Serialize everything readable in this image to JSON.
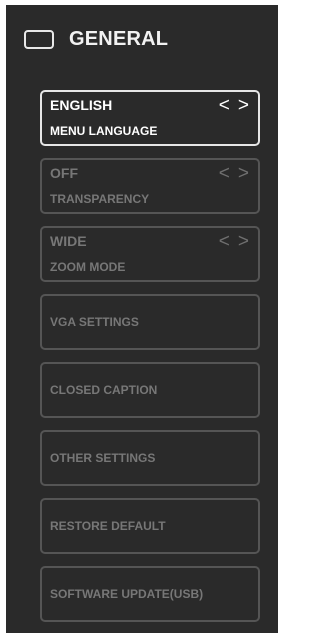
{
  "header": {
    "title": "GENERAL",
    "icon": "tv-screen-icon"
  },
  "items": [
    {
      "value": "ENGLISH",
      "label": "MENU LANGUAGE",
      "left_arrow": "<",
      "right_arrow": ">"
    },
    {
      "value": "OFF",
      "label": "TRANSPARENCY",
      "left_arrow": "<",
      "right_arrow": ">"
    },
    {
      "value": "WIDE",
      "label": "ZOOM MODE",
      "left_arrow": "<",
      "right_arrow": ">"
    },
    {
      "label": "VGA SETTINGS"
    },
    {
      "label": "CLOSED CAPTION"
    },
    {
      "label": "OTHER SETTINGS"
    },
    {
      "label": "RESTORE DEFAULT"
    },
    {
      "label": "SOFTWARE UPDATE(USB)"
    }
  ],
  "colors": {
    "panel_bg": "#2a2a2a",
    "active": "#ffffff",
    "inactive": "#777777"
  }
}
